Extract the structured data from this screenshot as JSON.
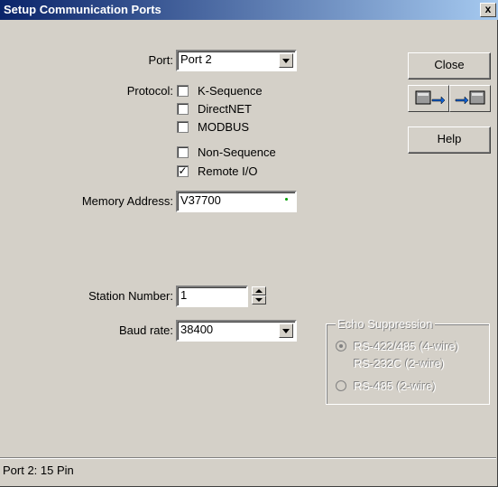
{
  "window": {
    "title": "Setup Communication Ports",
    "close_glyph": "x"
  },
  "port": {
    "label": "Port:",
    "value": "Port 2"
  },
  "protocol": {
    "label": "Protocol:",
    "options": [
      {
        "label": "K-Sequence",
        "checked": false
      },
      {
        "label": "DirectNET",
        "checked": false
      },
      {
        "label": "MODBUS",
        "checked": false
      },
      {
        "label": "Non-Sequence",
        "checked": false
      },
      {
        "label": "Remote I/O",
        "checked": true
      }
    ]
  },
  "memory_address": {
    "label": "Memory Address:",
    "value": "V37700"
  },
  "station_number": {
    "label": "Station Number:",
    "value": "1"
  },
  "baud_rate": {
    "label": "Baud rate:",
    "value": "38400"
  },
  "buttons": {
    "close": "Close",
    "help": "Help",
    "upload_icon": "read-from-plc-icon",
    "download_icon": "write-to-plc-icon"
  },
  "echo_suppression": {
    "title": "Echo Suppression",
    "options": [
      {
        "label": "RS-422/485 (4-wire)",
        "label2": "RS-232C (2-wire)",
        "selected": true
      },
      {
        "label": "RS-485 (2-wire)",
        "selected": false
      }
    ]
  },
  "status_bar": {
    "text": "Port 2: 15 Pin"
  },
  "colors": {
    "titlebar_start": "#0a246a",
    "titlebar_end": "#a6caf0",
    "face": "#d4d0c8"
  }
}
